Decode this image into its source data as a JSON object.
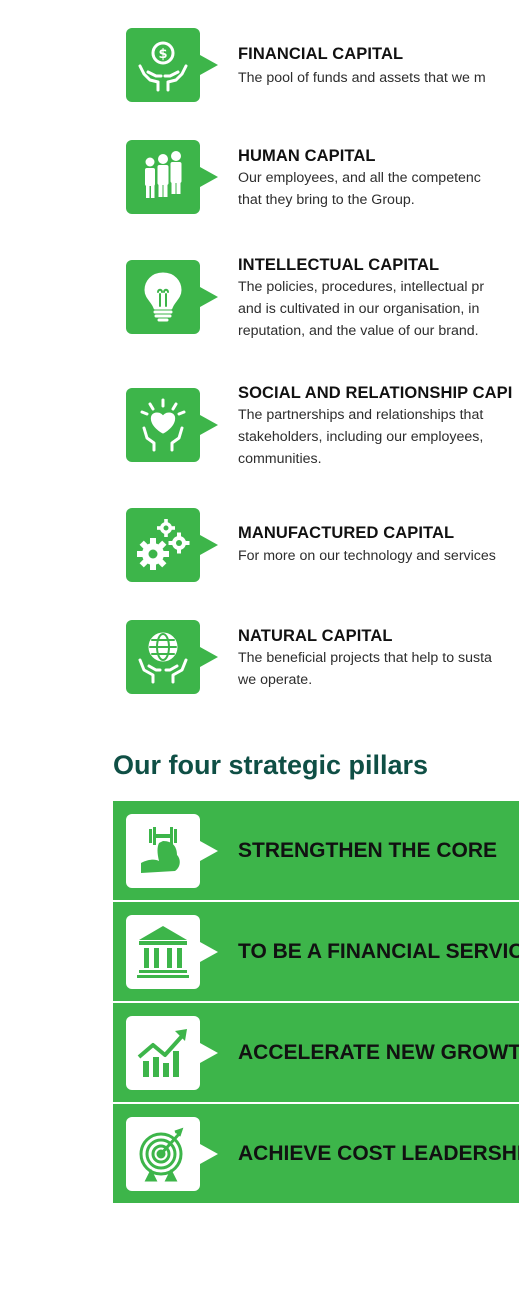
{
  "capitals": [
    {
      "icon": "hands-holding-coin-icon",
      "title": "FINANCIAL CAPITAL",
      "description": "The pool of funds and assets that we m"
    },
    {
      "icon": "people-group-icon",
      "title": "HUMAN CAPITAL",
      "description": "Our employees, and all the competenc\nthat they bring to the Group."
    },
    {
      "icon": "lightbulb-icon",
      "title": "INTELLECTUAL CAPITAL",
      "description": "The policies, procedures, intellectual pr\nand is cultivated in our organisation, in\nreputation, and the value of our brand."
    },
    {
      "icon": "hands-holding-heart-icon",
      "title": "SOCIAL AND RELATIONSHIP CAPI",
      "description": "The partnerships and relationships that\nstakeholders, including our employees,\ncommunities."
    },
    {
      "icon": "gears-icon",
      "title": "MANUFACTURED CAPITAL",
      "description": "For more on our technology and services"
    },
    {
      "icon": "hands-holding-globe-icon",
      "title": "NATURAL CAPITAL",
      "description": "The beneficial projects that help to susta\nwe operate."
    }
  ],
  "pillars_heading": "Our four strategic pillars",
  "pillars": [
    {
      "icon": "flexed-arm-dumbbell-icon",
      "label": "STRENGTHEN THE CORE"
    },
    {
      "icon": "bank-building-icon",
      "label": "TO BE A FINANCIAL SERVIC"
    },
    {
      "icon": "growth-chart-icon",
      "label": "ACCELERATE NEW GROWT"
    },
    {
      "icon": "target-icon",
      "label": "ACHIEVE COST LEADERSHI"
    }
  ],
  "colors": {
    "brand_green": "#3db54a",
    "heading_dark_green": "#0f4f45",
    "text_dark": "#111111"
  }
}
